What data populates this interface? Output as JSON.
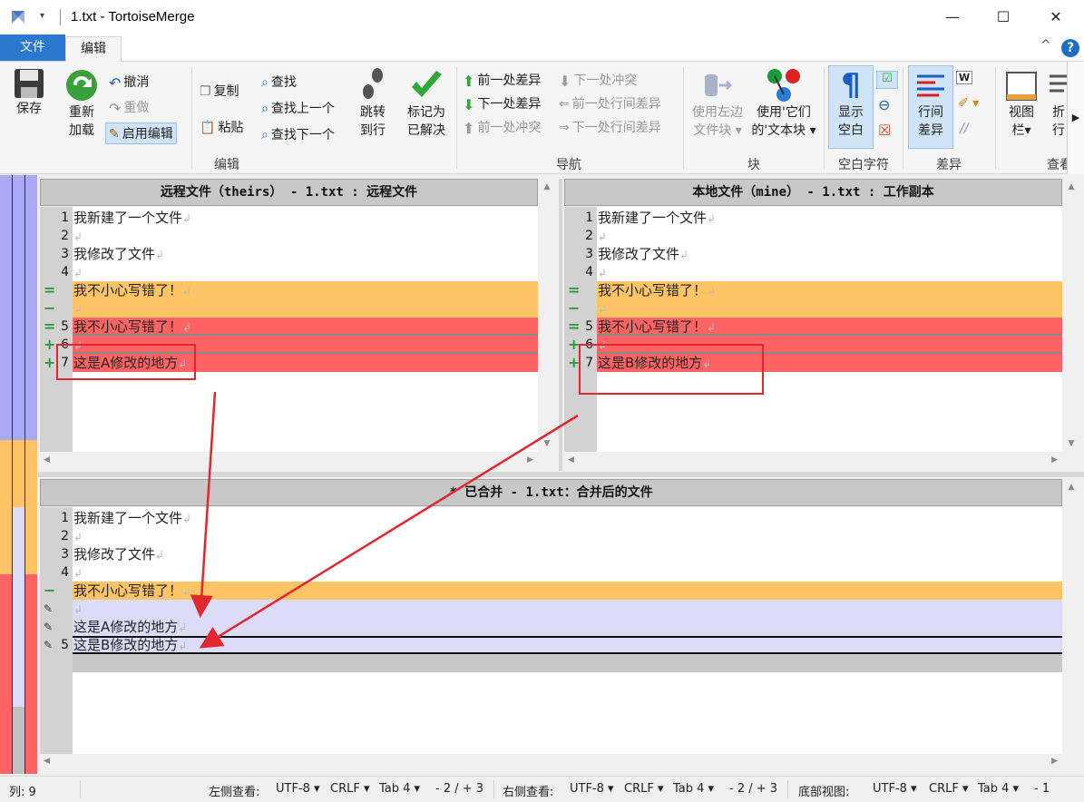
{
  "window": {
    "title": "1.txt - TortoiseMerge",
    "quick_access": "▾",
    "minimize": "—",
    "maximize": "☐",
    "close": "✕"
  },
  "ribbon_tabs": {
    "file": "文件",
    "edit": "编辑",
    "collapse": "^",
    "help": "?"
  },
  "ribbon": {
    "save": "保存",
    "reload_1": "重新",
    "reload_2": "加载",
    "undo": "撤消",
    "redo": "重做",
    "enable_edit": "启用编辑",
    "copy": "复制",
    "paste": "粘贴",
    "find": "查找",
    "find_prev": "查找上一个",
    "find_next": "查找下一个",
    "goto_1": "跳转",
    "goto_2": "到行",
    "mark_1": "标记为",
    "mark_2": "已解决",
    "group_edit": "编辑",
    "prev_diff": "前一处差异",
    "next_diff": "下一处差异",
    "prev_conflict": "前一处冲突",
    "next_conflict": "下一处冲突",
    "prev_inline": "前一处行间差异",
    "next_inline": "下一处行间差异",
    "group_nav": "导航",
    "use_left_1": "使用左边",
    "use_left_2": "文件块",
    "use_their_1": "使用'它们",
    "use_their_2": "的'文本块",
    "group_block": "块",
    "show_ws_1": "显示",
    "show_ws_2": "空白",
    "group_ws": "空白字符",
    "inline_1": "行间",
    "inline_2": "差异",
    "group_diff": "差异",
    "view_1": "视图",
    "view_2": "栏",
    "more_1": "折",
    "more_2": "行",
    "group_view": "查看"
  },
  "left_pane": {
    "header": "远程文件（theirs） - 1.txt : 远程文件",
    "lines": [
      {
        "num": "1",
        "text": "我新建了一个文件",
        "mark": ""
      },
      {
        "num": "2",
        "text": "",
        "mark": ""
      },
      {
        "num": "3",
        "text": "我修改了文件",
        "mark": ""
      },
      {
        "num": "4",
        "text": "",
        "mark": ""
      },
      {
        "num": "",
        "text": "我不小心写错了！",
        "mark": "="
      },
      {
        "num": "",
        "text": "",
        "mark": "−"
      },
      {
        "num": "5",
        "text": "我不小心写错了！",
        "mark": "="
      },
      {
        "num": "6",
        "text": "",
        "mark": "+"
      },
      {
        "num": "7",
        "text": "这是A修改的地方",
        "mark": "+"
      }
    ]
  },
  "right_pane": {
    "header": "本地文件（mine） - 1.txt : 工作副本",
    "lines": [
      {
        "num": "1",
        "text": "我新建了一个文件",
        "mark": ""
      },
      {
        "num": "2",
        "text": "",
        "mark": ""
      },
      {
        "num": "3",
        "text": "我修改了文件",
        "mark": ""
      },
      {
        "num": "4",
        "text": "",
        "mark": ""
      },
      {
        "num": "",
        "text": "我不小心写错了！",
        "mark": "="
      },
      {
        "num": "",
        "text": "",
        "mark": "−"
      },
      {
        "num": "5",
        "text": "我不小心写错了！",
        "mark": "="
      },
      {
        "num": "6",
        "text": "",
        "mark": "+"
      },
      {
        "num": "7",
        "text": "这是B修改的地方",
        "mark": "+"
      }
    ]
  },
  "bottom_pane": {
    "header": "* 已合并 - 1.txt：合并后的文件",
    "lines": [
      {
        "num": "1",
        "text": "我新建了一个文件",
        "mark": ""
      },
      {
        "num": "2",
        "text": "",
        "mark": ""
      },
      {
        "num": "3",
        "text": "我修改了文件",
        "mark": ""
      },
      {
        "num": "4",
        "text": "",
        "mark": ""
      },
      {
        "num": "",
        "text": "我不小心写错了！",
        "mark": "−"
      },
      {
        "num": "",
        "text": "",
        "mark": "✎"
      },
      {
        "num": "",
        "text": "这是A修改的地方",
        "mark": "✎"
      },
      {
        "num": "5",
        "text": "这是B修改的地方",
        "mark": "✎"
      }
    ]
  },
  "status": {
    "col": "列: 9",
    "left_view": "左侧查看:",
    "left_enc": "UTF-8",
    "left_eol": "CRLF",
    "left_tab": "Tab 4",
    "left_diff": "- 2 / + 3",
    "right_view": "右侧查看:",
    "right_enc": "UTF-8",
    "right_eol": "CRLF",
    "right_tab": "Tab 4",
    "right_diff": "- 2 / + 3",
    "bottom_view": "底部视图:",
    "bottom_enc": "UTF-8",
    "bottom_eol": "CRLF",
    "bottom_tab": "Tab 4",
    "bottom_diff": "- 1"
  },
  "colors": {
    "conflict_orange": "#ffc465",
    "removed_red": "#ff6363",
    "edited_lavender": "#dcdcf8",
    "annotation_red": "#e0282e"
  }
}
